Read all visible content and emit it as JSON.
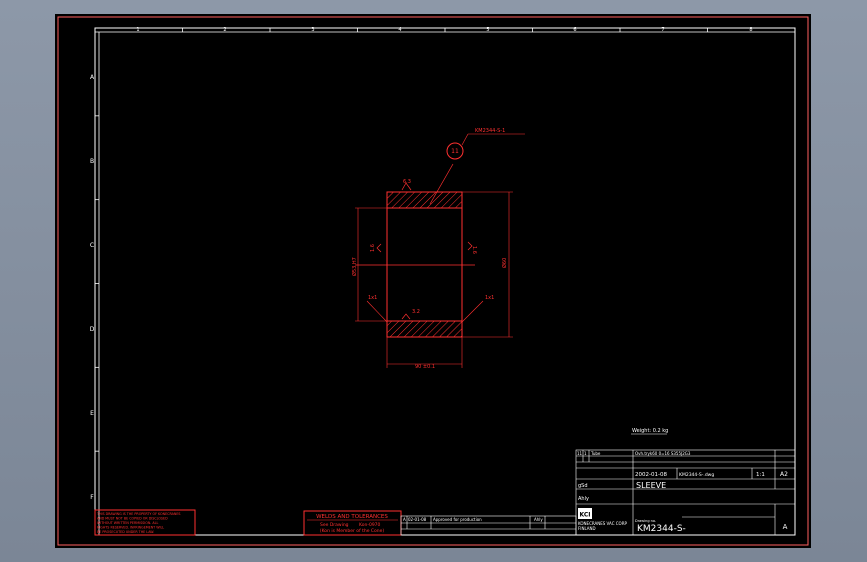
{
  "frame": {
    "columns": [
      "1",
      "2",
      "3",
      "4",
      "5",
      "6",
      "7",
      "8"
    ],
    "rows": [
      "A",
      "B",
      "C",
      "D",
      "E",
      "F"
    ]
  },
  "part": {
    "ref_label": "KM2344-S-1",
    "balloon": "11",
    "roughness_top": "6.3",
    "roughness_bore_left": "1.6",
    "roughness_bore_right": "1.6",
    "roughness_bottom": "3.2",
    "dim_inner_diameter": "Ø53 H7",
    "dim_outer_diameter": "Ø60",
    "dim_length": "90 ±0.1",
    "chamfer_left": "1x1",
    "chamfer_right": "1x1"
  },
  "weight_note": "Weight: 0.2 kg",
  "welds_box": {
    "title": "WELDS AND TOLERANCES",
    "line1_left": "See Drawing",
    "line1_right": "Kon-0970",
    "line2": "(Kon is Member of the Cone)"
  },
  "warning_lines": [
    "THIS DRAWING IS THE PROPERTY OF KONECRANES",
    "AND MUST NOT BE COPIED OR DISCLOSED",
    "WITHOUT WRITTEN PERMISSION. ALL",
    "RIGHTS RESERVED. INFRINGEMENT WILL",
    "BE PROSECUTED UNDER THE LAW."
  ],
  "revision": {
    "letter": "A",
    "date": "02-01-08",
    "text": "Approved for production",
    "signed": "Ahly"
  },
  "title_block": {
    "material_no": "11",
    "qty": "1",
    "material_type": "Tube",
    "material_spec": "Ovh.tryk60 0=16 S355J2G3",
    "date": "2002-01-08",
    "file": "KM2344-S-.dwg",
    "scale": "1:1",
    "size": "A2",
    "drawn_by": "gSd",
    "checked_by": "Ahly",
    "title": "SLEEVE",
    "logo_text": "KCI",
    "company": "KONECRANES VAC CORP",
    "country": "FINLAND",
    "drawing_no_label": "Drawing no.",
    "drawing_no": "KM2344-S-",
    "revision": "A"
  },
  "colors": {
    "background": "#000000",
    "frame": "#ffffff",
    "part": "#ff3030",
    "title_block": "#ffffff"
  }
}
